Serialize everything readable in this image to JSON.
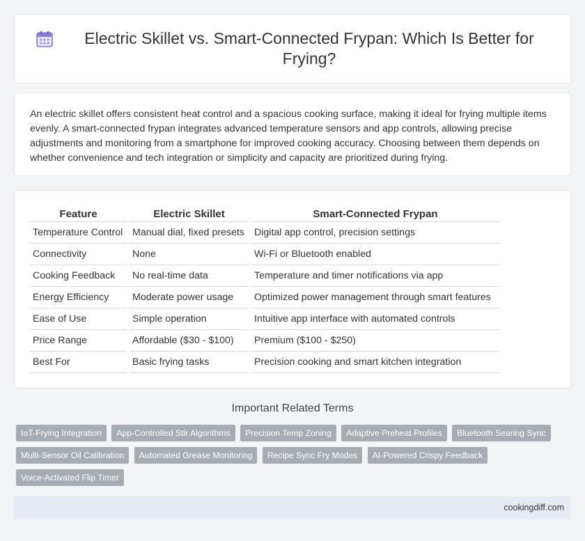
{
  "title": "Electric Skillet vs. Smart-Connected Frypan: Which Is Better for Frying?",
  "title_icon": "calendar-icon",
  "intro": "An electric skillet offers consistent heat control and a spacious cooking surface, making it ideal for frying multiple items evenly. A smart-connected frypan integrates advanced temperature sensors and app controls, allowing precise adjustments and monitoring from a smartphone for improved cooking accuracy. Choosing between them depends on whether convenience and tech integration or simplicity and capacity are prioritized during frying.",
  "table": {
    "headers": [
      "Feature",
      "Electric Skillet",
      "Smart-Connected Frypan"
    ],
    "rows": [
      [
        "Temperature Control",
        "Manual dial, fixed presets",
        "Digital app control, precision settings"
      ],
      [
        "Connectivity",
        "None",
        "Wi-Fi or Bluetooth enabled"
      ],
      [
        "Cooking Feedback",
        "No real-time data",
        "Temperature and timer notifications via app"
      ],
      [
        "Energy Efficiency",
        "Moderate power usage",
        "Optimized power management through smart features"
      ],
      [
        "Ease of Use",
        "Simple operation",
        "Intuitive app interface with automated controls"
      ],
      [
        "Price Range",
        "Affordable ($30 - $100)",
        "Premium ($100 - $250)"
      ],
      [
        "Best For",
        "Basic frying tasks",
        "Precision cooking and smart kitchen integration"
      ]
    ]
  },
  "related": {
    "title": "Important Related Terms",
    "tags": [
      "IoT-Frying Integration",
      "App-Controlled Stir Algorithms",
      "Precision Temp Zoning",
      "Adaptive Preheat Profiles",
      "Bluetooth Searing Sync",
      "Multi-Sensor Oil Calibration",
      "Automated Grease Monitoring",
      "Recipe Sync Fry Modes",
      "AI-Powered Crispy Feedback",
      "Voice-Activated Flip Timer"
    ]
  },
  "footer": {
    "site": "cookingdiff.com"
  },
  "colors": {
    "page_bg": "#f3f4f6",
    "tag_bg": "#a7abb2",
    "footer_bg": "#e7ebf3",
    "icon_accent": "#8b7ad6"
  }
}
